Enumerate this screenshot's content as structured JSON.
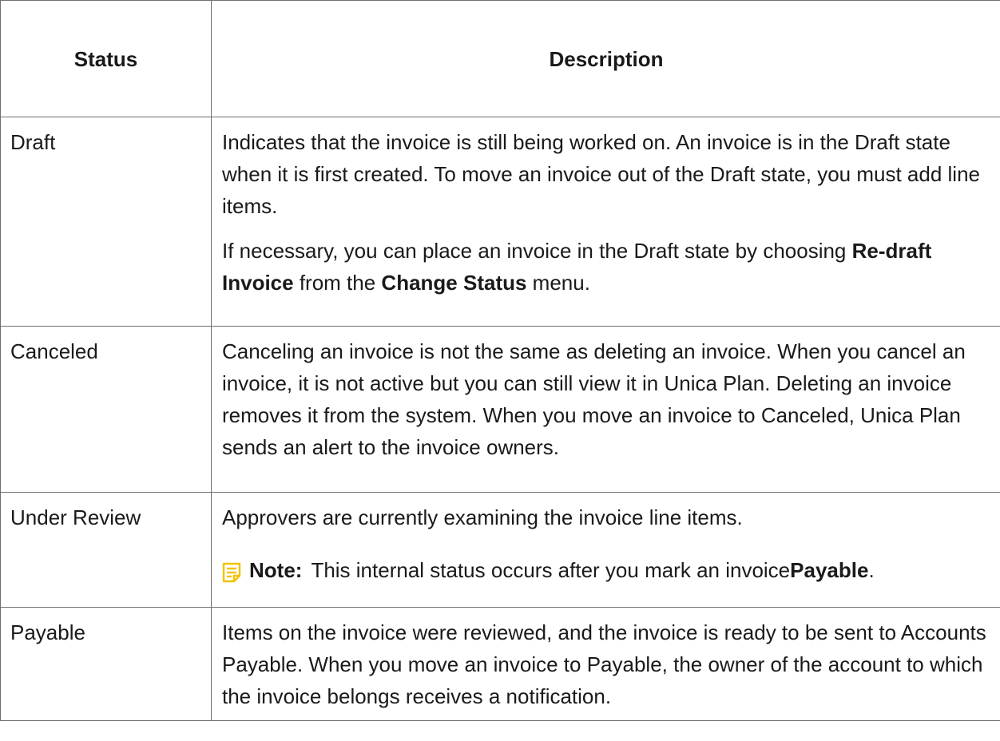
{
  "table": {
    "headers": {
      "status": "Status",
      "description": "Description"
    },
    "rows": [
      {
        "status": "Draft",
        "p1": "Indicates that the invoice is still being worked on. An invoice is in the Draft state when it is first created. To move an invoice out of the Draft state, you must add line items.",
        "p2_before": "If necessary, you can place an invoice in the Draft state by choosing ",
        "p2_bold1": "Re-draft Invoice",
        "p2_mid": " from the ",
        "p2_bold2": "Change Status",
        "p2_after": " menu."
      },
      {
        "status": "Canceled",
        "p1": "Canceling an invoice is not the same as deleting an invoice. When you cancel an invoice, it is not active but you can still view it in Unica Plan. Deleting an invoice removes it from the system. When you move an invoice to Canceled, Unica Plan sends an alert to the invoice owners."
      },
      {
        "status": "Under Review",
        "p1": "Approvers are currently examining the invoice line items.",
        "note_icon": "note-icon",
        "note_label": "Note:",
        "note_text": "This internal status occurs after you mark an invoice ",
        "note_bold": "Payable",
        "note_end": "."
      },
      {
        "status": "Payable",
        "p1": "Items on the invoice were reviewed, and the invoice is ready to be sent to Accounts Payable. When you move an invoice to Payable, the owner of the account to which the invoice belongs receives a notification."
      }
    ]
  },
  "colors": {
    "border": "#6f6f6f",
    "note_icon": "#f2c200"
  }
}
